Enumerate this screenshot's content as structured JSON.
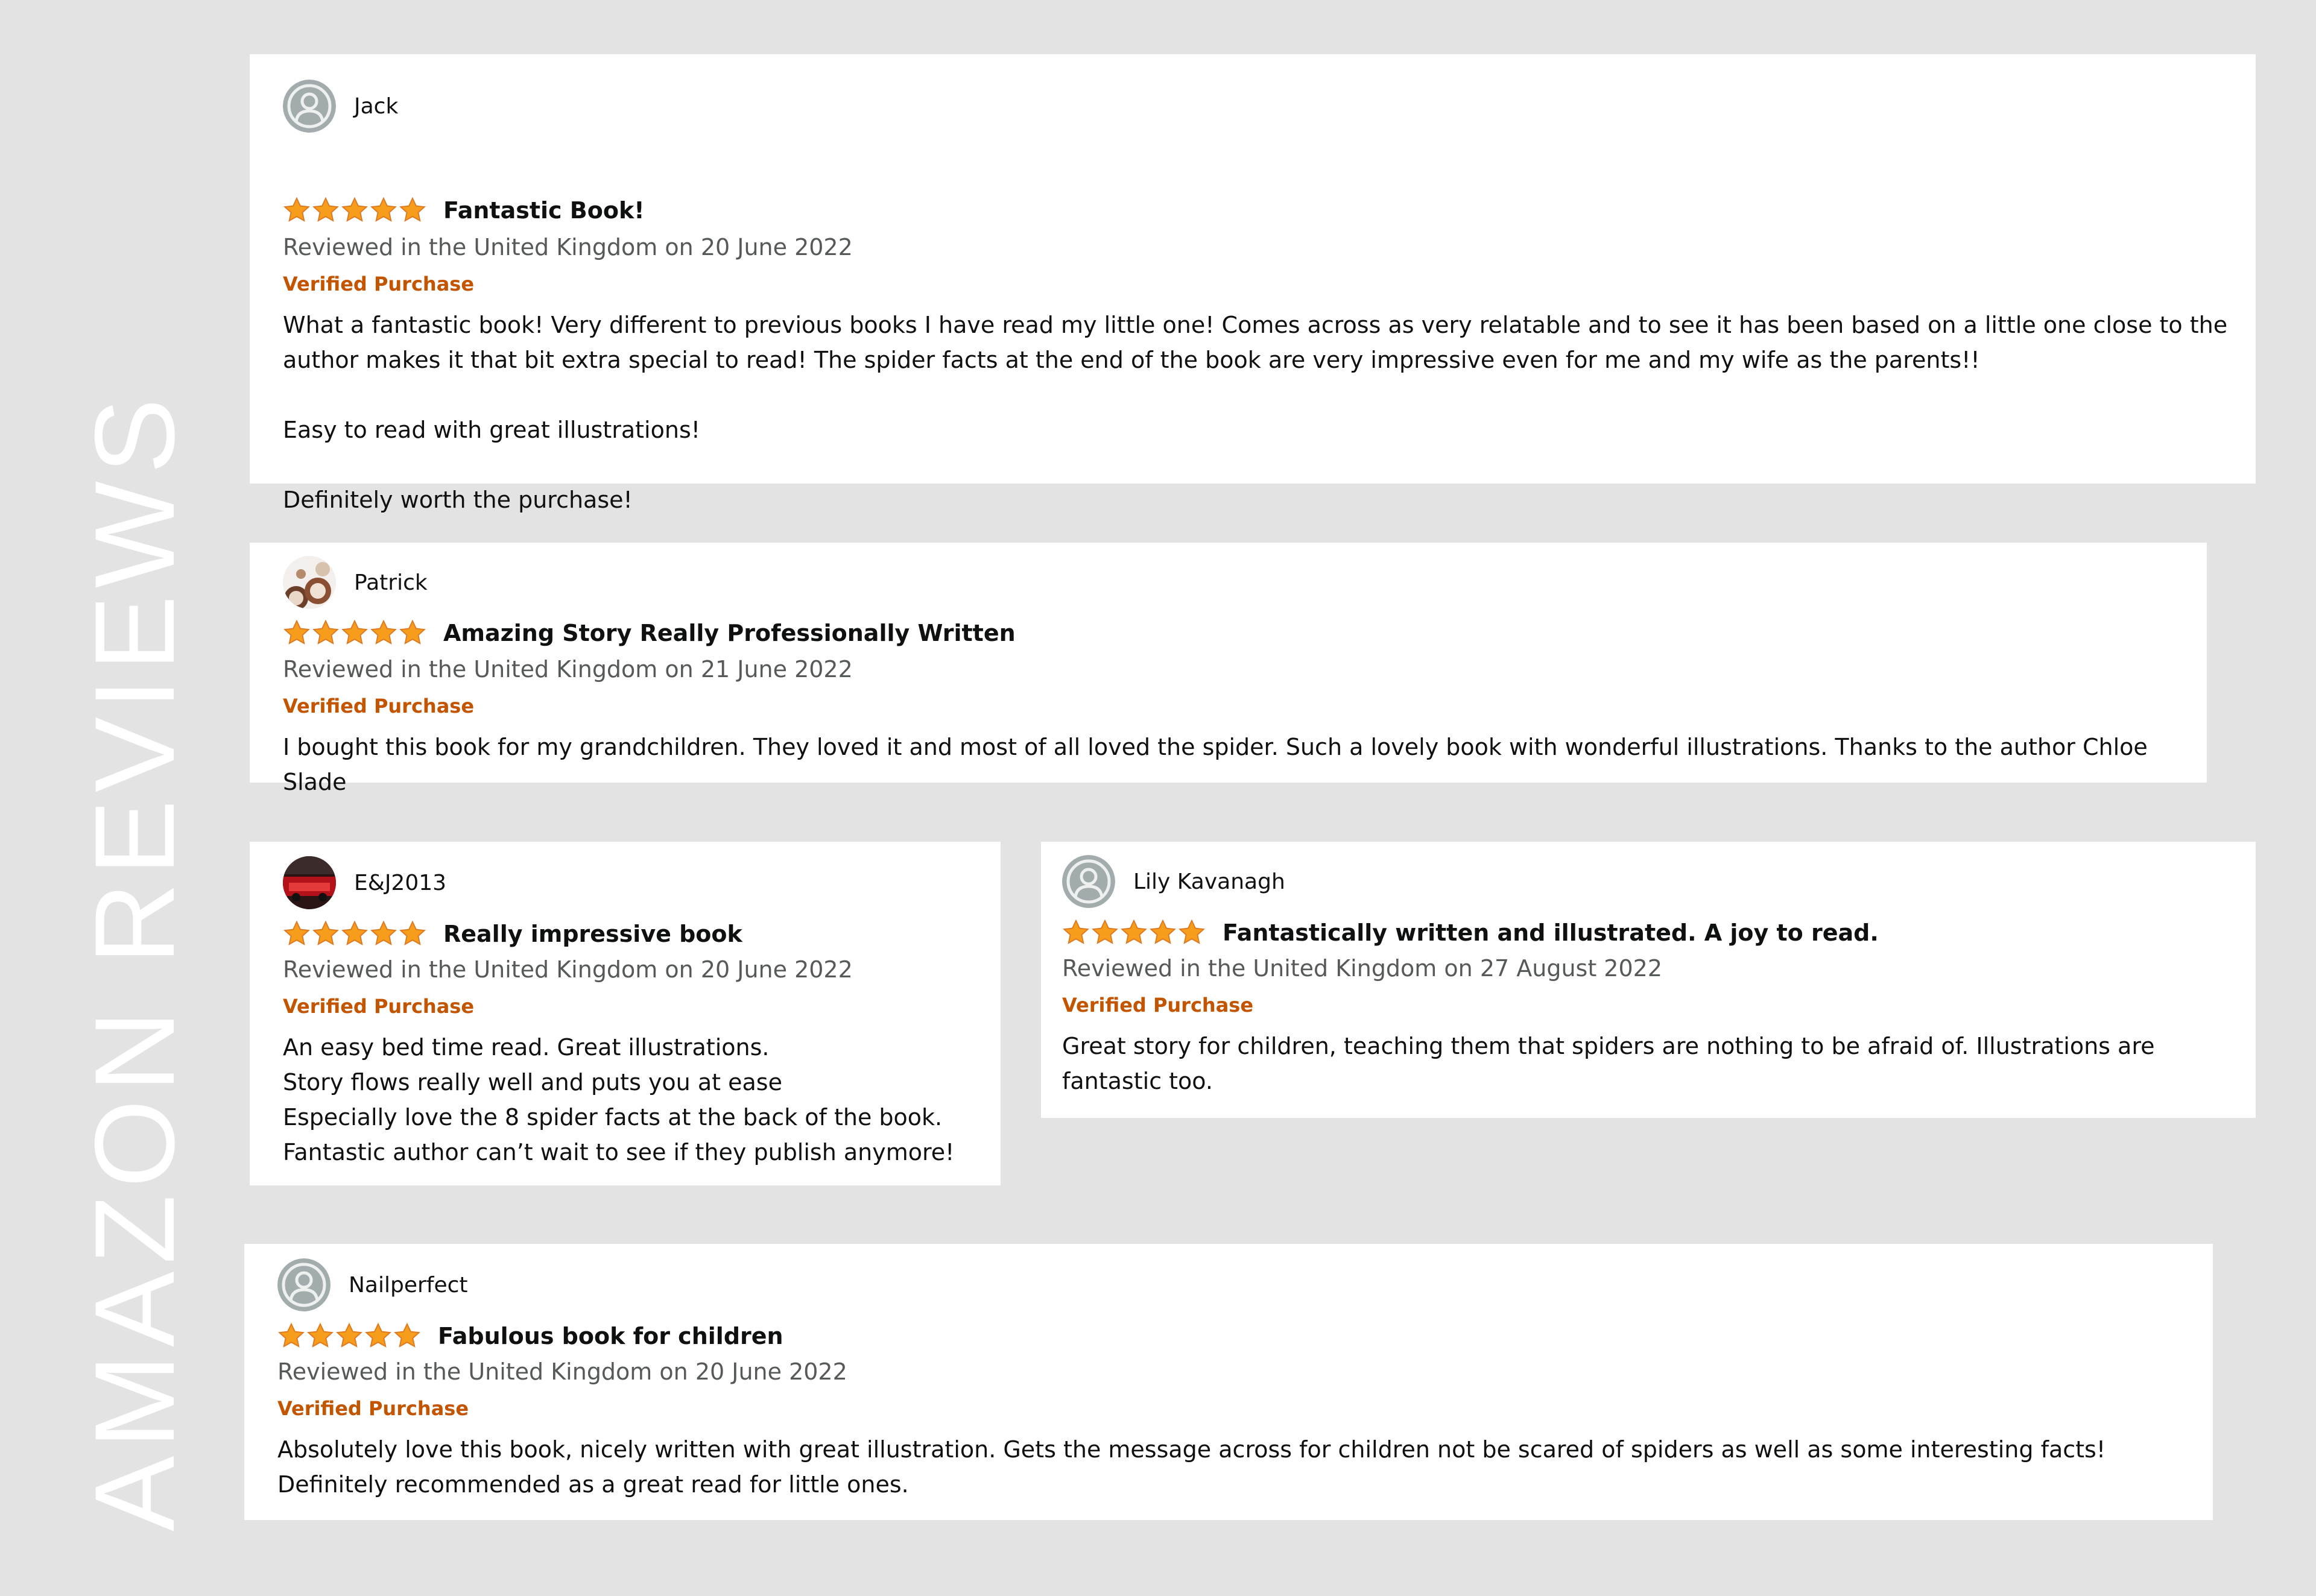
{
  "side_title": "AMAZON REVIEWS",
  "colors": {
    "background": "#e2e3e2",
    "card": "#ffffff",
    "star": "#f79d1c",
    "verified": "#c45500",
    "meta": "#565959"
  },
  "reviews": [
    {
      "user": "Jack",
      "avatar": "default-avatar-icon",
      "rating": 5,
      "title": "Fantastic Book!",
      "meta": "Reviewed in the United Kingdom on 20 June 2022",
      "verified": "Verified Purchase",
      "body": [
        "What a fantastic book! Very different to previous books I have read my little one! Comes across as very relatable and to see it has been based on a little one close to the author makes it that bit extra special to read! The spider facts at the end of the book are very impressive even for me and my wife as the parents!!",
        "Easy to read with great illustrations!",
        "Definitely worth the purchase!"
      ]
    },
    {
      "user": "Patrick",
      "avatar": "photo-avatar",
      "rating": 5,
      "title": "Amazing Story Really Professionally Written",
      "meta": "Reviewed in the United Kingdom on 21 June 2022",
      "verified": "Verified Purchase",
      "body": [
        "I bought this book for my grandchildren. They loved it and most of all loved the spider. Such a lovely book with wonderful illustrations. Thanks to the author Chloe Slade"
      ]
    },
    {
      "user": "E&J2013",
      "avatar": "photo-avatar",
      "rating": 5,
      "title": "Really impressive book",
      "meta": "Reviewed in the United Kingdom on 20 June 2022",
      "verified": "Verified Purchase",
      "body": [
        "An easy bed time read. Great illustrations.",
        "Story flows really well and puts you at ease",
        "Especially love the 8 spider facts at the back of the book.",
        "Fantastic author can’t wait to see if they publish anymore!"
      ]
    },
    {
      "user": "Lily Kavanagh",
      "avatar": "default-avatar-icon",
      "rating": 5,
      "title": "Fantastically written and illustrated. A joy to read.",
      "meta": "Reviewed in the United Kingdom on 27 August 2022",
      "verified": "Verified Purchase",
      "body": [
        "Great story for children, teaching them that spiders are nothing to be afraid of. Illustrations are fantastic too."
      ]
    },
    {
      "user": "Nailperfect",
      "avatar": "default-avatar-icon",
      "rating": 5,
      "title": "Fabulous book for children",
      "meta": "Reviewed in the United Kingdom on 20 June 2022",
      "verified": "Verified Purchase",
      "body": [
        "Absolutely love this book, nicely written with great illustration. Gets the message across for children not be scared of spiders as well as some interesting facts! Definitely recommended as a great read for little ones."
      ]
    }
  ]
}
